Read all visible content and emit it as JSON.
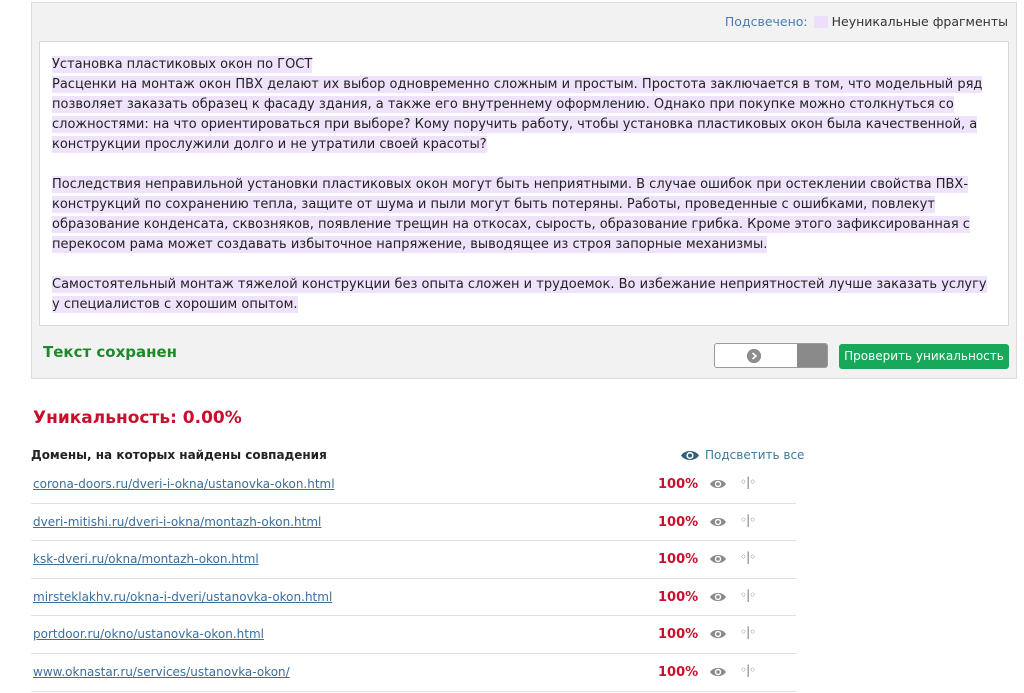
{
  "legend": {
    "label": "Подсвечено:",
    "text": "Неуникальные фрагменты"
  },
  "text": {
    "paragraphs": [
      "Установка пластиковых окон по ГОСТ\nРасценки на монтаж окон ПВХ делают их выбор одновременно сложным и простым. Простота заключается в том, что модельный ряд позволяет заказать образец к фасаду здания, а также его внутреннему оформлению. Однако при покупке можно столкнуться со сложностями: на что ориентироваться при выборе? Кому поручить работу, чтобы установка пластиковых окон была качественной, а конструкции прослужили долго и не утратили своей красоты?",
      "Последствия неправильной установки пластиковых окон могут быть неприятными. В случае ошибок при остеклении свойства ПВХ-конструкций по сохранению тепла, защите от шума и пыли могут быть потеряны. Работы, проведенные с ошибками, повлекут образование конденсата, сквозняков, появление трещин на откосах, сырость, образование грибка. Кроме этого зафиксированная с перекосом рама может создавать избыточное напряжение, выводящее из строя запорные механизмы.",
      "Самостоятельный монтаж тяжелой конструкции без опыта сложен и трудоемок. Во избежание неприятностей лучше заказать услугу у специалистов с хорошим опытом."
    ]
  },
  "status": {
    "saved": "Текст сохранен"
  },
  "toggle": {
    "icon": "arrow-right-circle-icon"
  },
  "check_button": "Проверить уникальность",
  "uniqueness": "Уникальность: 0.00%",
  "domains": {
    "heading": "Домены, на которых найдены совпадения",
    "highlight_all": "Подсветить все",
    "rows": [
      {
        "url": "corona-doors.ru/dveri-i-okna/ustanovka-okon.html",
        "percent": "100%"
      },
      {
        "url": "dveri-mitishi.ru/dveri-i-okna/montazh-okon.html",
        "percent": "100%"
      },
      {
        "url": "ksk-dveri.ru/okna/montazh-okon.html",
        "percent": "100%"
      },
      {
        "url": "mirsteklakhv.ru/okna-i-dveri/ustanovka-okon.html",
        "percent": "100%"
      },
      {
        "url": "portdoor.ru/okno/ustanovka-okon.html",
        "percent": "100%"
      },
      {
        "url": "www.oknastar.ru/services/ustanovka-okon/",
        "percent": "100%"
      }
    ],
    "compare_glyph": "◦|◦"
  },
  "colors": {
    "highlight": "#efe3fb",
    "accent_green": "#17a85a",
    "alert_red": "#c8102e",
    "link_blue": "#3b6e9b"
  }
}
